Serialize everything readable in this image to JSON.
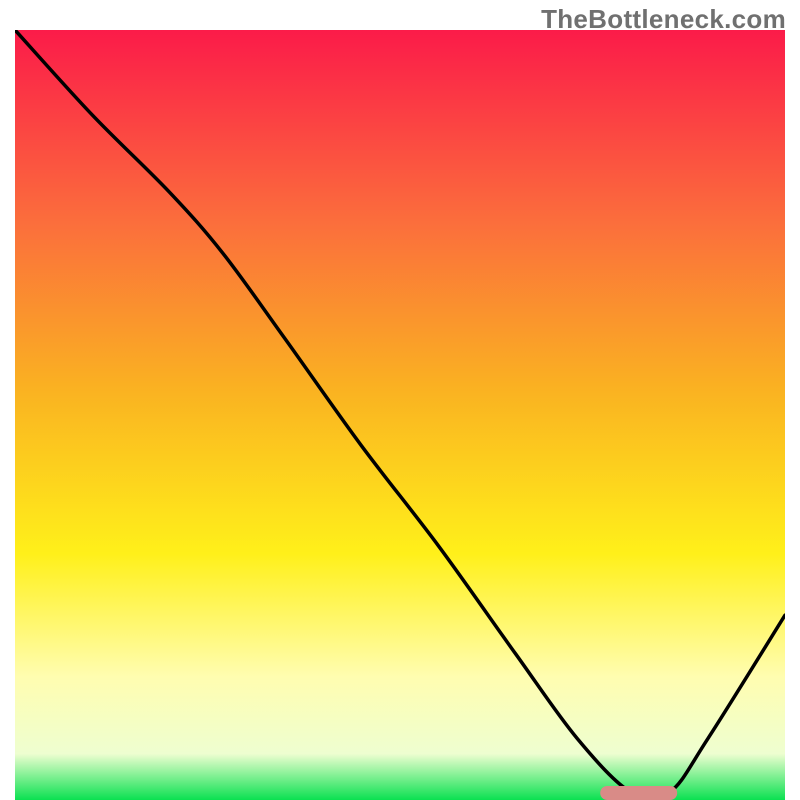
{
  "watermark": "TheBottleneck.com",
  "chart_data": {
    "type": "line",
    "title": "",
    "xlabel": "",
    "ylabel": "",
    "xlim": [
      0,
      100
    ],
    "ylim": [
      0,
      100
    ],
    "grid": false,
    "legend": false,
    "series": [
      {
        "name": "bottleneck-curve",
        "x": [
          0,
          10,
          20,
          27,
          35,
          45,
          55,
          65,
          73,
          80,
          85,
          90,
          100
        ],
        "y": [
          100,
          89,
          79,
          71,
          60,
          46,
          33,
          19,
          8,
          1,
          1,
          8,
          24
        ]
      }
    ],
    "marker": {
      "name": "optimal-zone",
      "x_start": 76,
      "x_end": 86,
      "y": 0,
      "color": "#d98b87"
    },
    "gradient_stops": [
      {
        "offset": 0,
        "color": "#fb1b49"
      },
      {
        "offset": 0.25,
        "color": "#fb6e3c"
      },
      {
        "offset": 0.47,
        "color": "#fab321"
      },
      {
        "offset": 0.68,
        "color": "#fff01a"
      },
      {
        "offset": 0.84,
        "color": "#fffdb0"
      },
      {
        "offset": 0.94,
        "color": "#eefed0"
      },
      {
        "offset": 1.0,
        "color": "#0be151"
      }
    ]
  }
}
